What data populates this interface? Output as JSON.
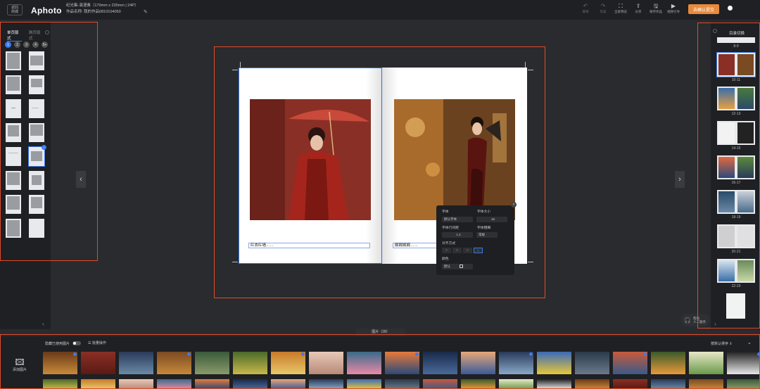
{
  "header": {
    "back_label": "返回\n商城",
    "logo": "Aphoto",
    "project_line1": "纪光集-演漫素（170mm x 235mm | 24P）",
    "project_line2": "作品名称: 我的作品0810104050",
    "tools": [
      {
        "icon": "↶",
        "label": "撤销",
        "dim": true
      },
      {
        "icon": "↷",
        "label": "恢复",
        "dim": true
      },
      {
        "icon": "⛶",
        "label": "全屏预览",
        "dim": false
      },
      {
        "icon": "⇪",
        "label": "分享",
        "dim": false
      },
      {
        "icon": "🖫",
        "label": "保存作品",
        "dim": false
      },
      {
        "icon": "▶",
        "label": "视频引导",
        "dim": false
      }
    ],
    "order_button": "去确认提交"
  },
  "left_panel": {
    "tabs": [
      "单页版式",
      "跨页版式"
    ],
    "page_numbers": [
      "1",
      "2",
      "3",
      "4",
      "5+"
    ]
  },
  "canvas": {
    "caption_left": "红衣红墙……",
    "caption_right": "娓娓娓娓……",
    "prev_icon": "‹",
    "next_icon": "›"
  },
  "text_popup": {
    "font_label": "字体",
    "size_label": "字体大小",
    "font_value": "默认字体",
    "size_value": "16",
    "line_spacing_label": "字体行间距",
    "weight_label": "字体粗细",
    "line_spacing_value": "1.2",
    "weight_value": "常规",
    "align_label": "对齐方式",
    "color_label": "颜色",
    "color_value": "默认"
  },
  "right_panel": {
    "title": "目录切换",
    "spreads": [
      "8-9",
      "10-11",
      "12-13",
      "14-15",
      "16-17",
      "18-19",
      "20-21",
      "22-23"
    ]
  },
  "bottom": {
    "tab_label": "图片（28）",
    "add_photo": "添加图片",
    "hide_used": "隐藏已使用图片",
    "batch": "批量操作",
    "sort": "按默认排序"
  },
  "help_label": "帮助\n人工服务",
  "colors": {
    "accent": "#3a7bf0",
    "order_button": "#e88a3c",
    "highlight_box": "#e04a2a"
  }
}
